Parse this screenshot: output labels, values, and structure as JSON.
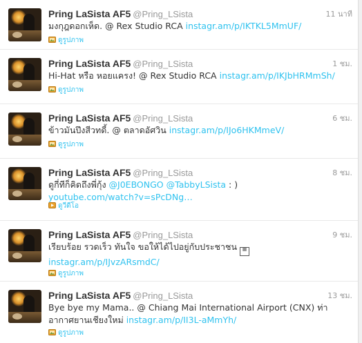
{
  "tweets": [
    {
      "name": "Pring LaSista AF5",
      "handle": "@Pring_LSista",
      "time": "11 นาที",
      "text": "มงกุฎดอกเห็ด. @ Rex Studio RCA ",
      "link": "instagr.am/p/IKTKL5MmUF/",
      "expand_label": "ดูรูปภาพ",
      "expand_icon": "photo-icon"
    },
    {
      "name": "Pring LaSista AF5",
      "handle": "@Pring_LSista",
      "time": "1 ชม.",
      "text": "Hi-Hat หรือ หอยแครง! @ Rex Studio RCA ",
      "link": "instagr.am/p/IKJbHRMmSh/",
      "expand_label": "ดูรูปภาพ",
      "expand_icon": "photo-icon"
    },
    {
      "name": "Pring LaSista AF5",
      "handle": "@Pring_LSista",
      "time": "6 ชม.",
      "text": "ข้าวมันปึงสีวทดี้. @ ตลาดอัศวิน ",
      "link": "instagr.am/p/IJo6HKMmeV/",
      "expand_label": "ดูรูปภาพ",
      "expand_icon": "photo-icon"
    },
    {
      "name": "Pring LaSista AF5",
      "handle": "@Pring_LSista",
      "time": "8 ชม.",
      "text_pre": "ดูกี่ทีก็คิดถึงพี่กุ้ง ",
      "mention1": "@J0EBONGO",
      "mention2": "@TabbyLSista",
      "text_post": " : )",
      "link": "youtube.com/watch?v=sPcDNg…",
      "expand_label": "ดูวีดีโอ",
      "expand_icon": "video-icon"
    },
    {
      "name": "Pring LaSista AF5",
      "handle": "@Pring_LSista",
      "time": "9 ชม.",
      "text": "เรียบร้อย รวดเร็ว ทันใจ ขอให้ได้ไปอยู่กับประชาชน",
      "link": "instagr.am/p/IJvzARsmdC/",
      "expand_label": "ดูรูปภาพ",
      "expand_icon": "photo-icon"
    },
    {
      "name": "Pring LaSista AF5",
      "handle": "@Pring_LSista",
      "time": "13 ชม.",
      "text": "Bye bye my Mama.. @ Chiang Mai International Airport (CNX) ท่าอากาศยานเชียงใหม่ ",
      "link": "instagr.am/p/II3L-aMmYh/",
      "expand_label": "ดูรูปภาพ",
      "expand_icon": "photo-icon"
    }
  ]
}
